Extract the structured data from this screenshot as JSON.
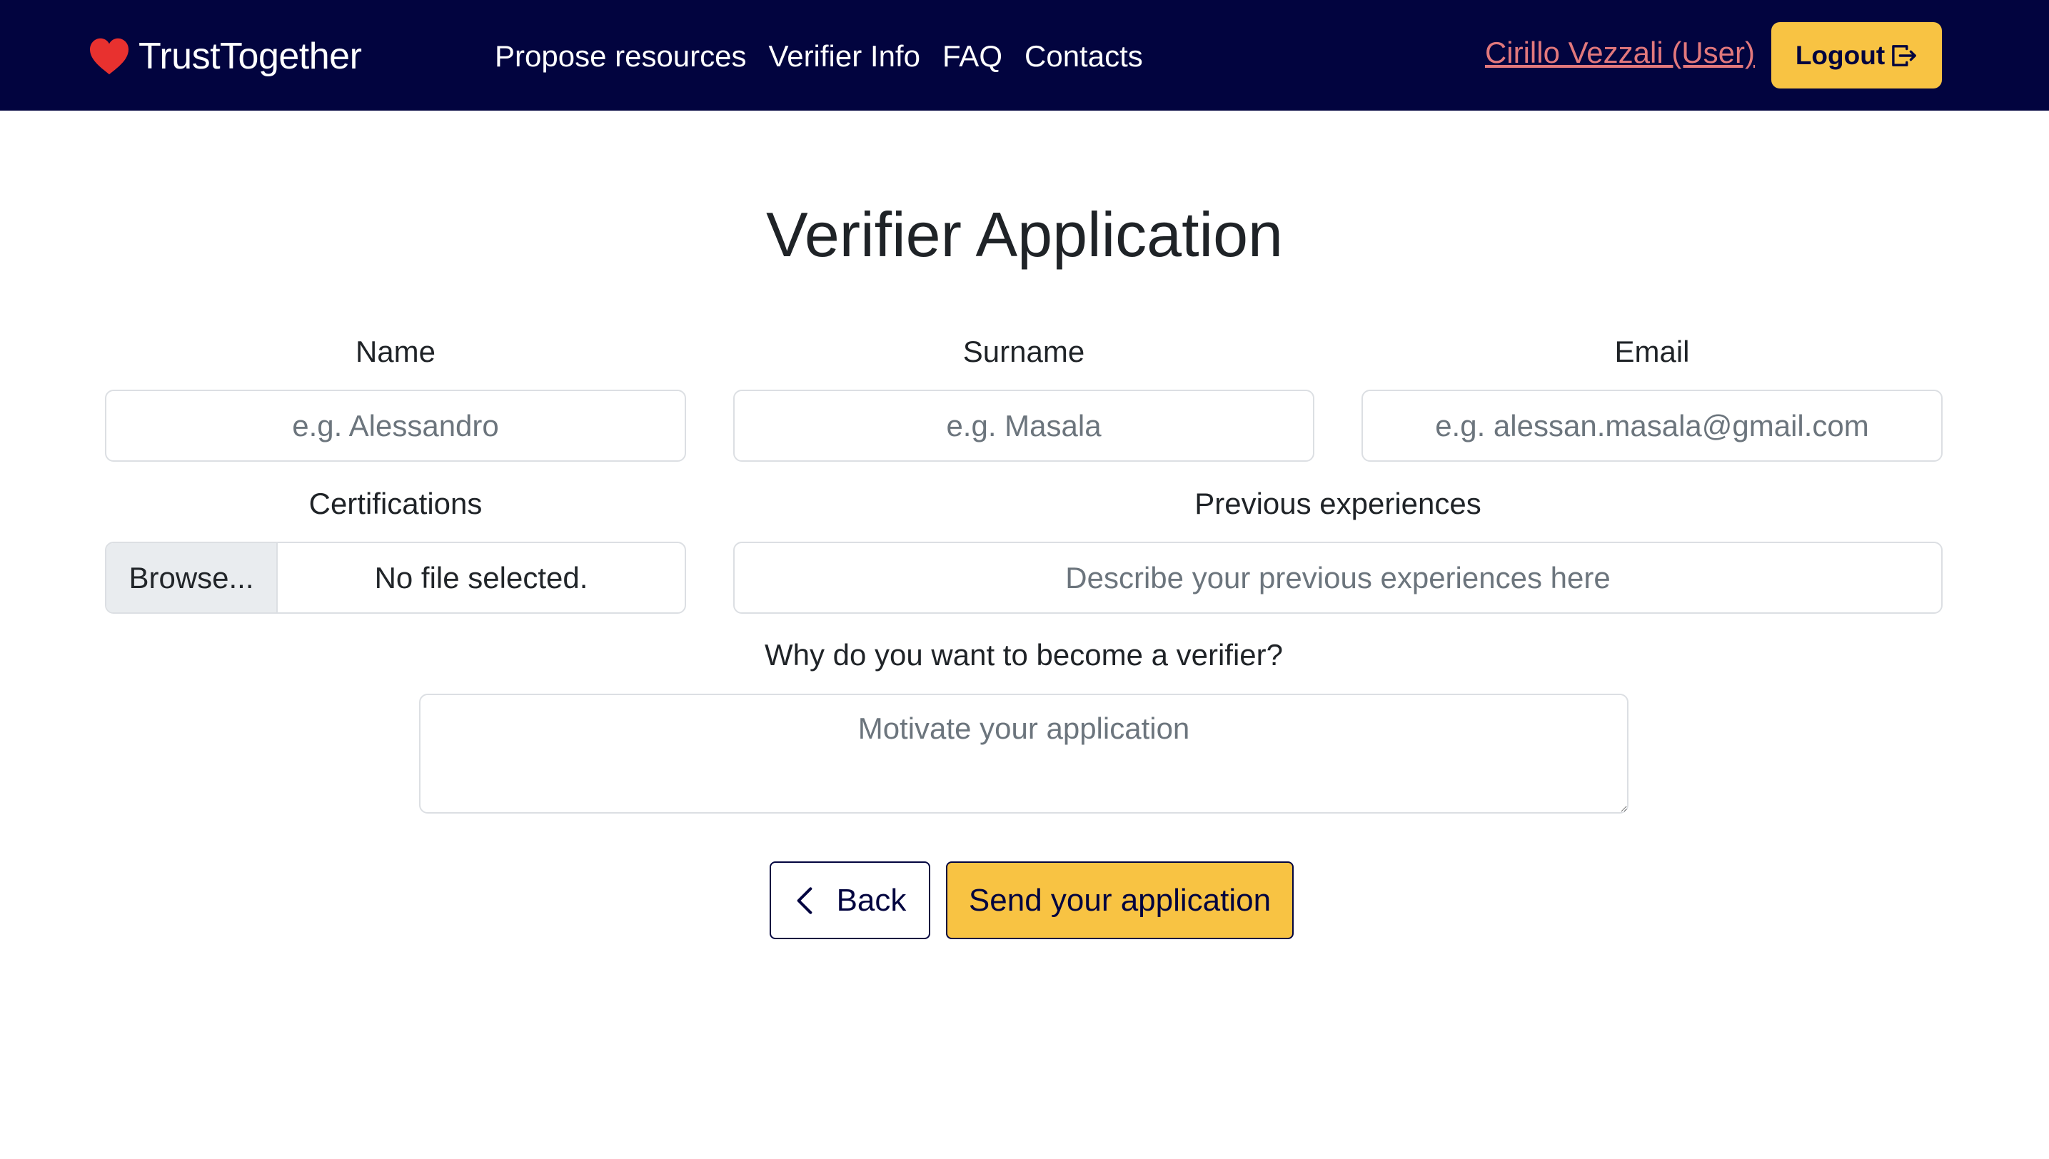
{
  "navbar": {
    "brand": "TrustTogether",
    "links": [
      "Propose resources",
      "Verifier Info",
      "FAQ",
      "Contacts"
    ],
    "user": "Cirillo Vezzali (User)",
    "logout": "Logout"
  },
  "form": {
    "title": "Verifier Application",
    "name": {
      "label": "Name",
      "placeholder": "e.g. Alessandro"
    },
    "surname": {
      "label": "Surname",
      "placeholder": "e.g. Masala"
    },
    "email": {
      "label": "Email",
      "placeholder": "e.g. alessan.masala@gmail.com"
    },
    "certifications": {
      "label": "Certifications",
      "browse": "Browse...",
      "file": "No file selected."
    },
    "experiences": {
      "label": "Previous experiences",
      "placeholder": "Describe your previous experiences here"
    },
    "motivation": {
      "label": "Why do you want to become a verifier?",
      "placeholder": "Motivate your application"
    },
    "back": "Back",
    "send": "Send your application"
  },
  "colors": {
    "navbar": "#02043f",
    "accent": "#f8c343",
    "user_link": "#e2787c",
    "heart": "#e8312f"
  },
  "icons": {
    "brand": "heart-icon",
    "logout": "logout-icon",
    "back": "chevron-left-icon"
  }
}
